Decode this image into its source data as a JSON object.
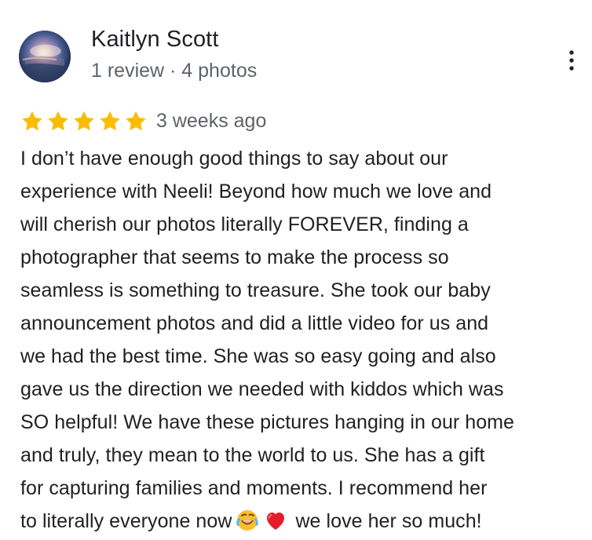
{
  "review": {
    "author": {
      "name": "Kaitlyn Scott",
      "meta": "1 review · 4 photos"
    },
    "rating": {
      "stars": 5,
      "max": 5,
      "time": "3 weeks ago"
    },
    "body_lines": [
      "I don’t have enough good things to say about our",
      "experience with Neeli! Beyond how much we love and",
      "will cherish our photos literally FOREVER, finding a",
      "photographer that seems to make the process so",
      "seamless is something to treasure. She took our baby",
      "announcement photos and did a little video for us and",
      "we had the best time. She was so easy going and also",
      "gave us the direction we needed with kiddos which was",
      "SO helpful! We have these pictures hanging in our home",
      "and truly, they mean to the world to us. She has a gift",
      "for capturing families and moments. I recommend her",
      "to literally everyone now"
    ],
    "body_trailing": "we love her so much!",
    "emojis": [
      "laughing-emoji",
      "red-heart-emoji"
    ]
  },
  "icons": {
    "menu": "more-vert-icon",
    "star": "star-icon",
    "avatar": "avatar"
  },
  "colors": {
    "text_primary": "#202124",
    "text_secondary": "#5f6368",
    "star": "#fbbc04"
  }
}
